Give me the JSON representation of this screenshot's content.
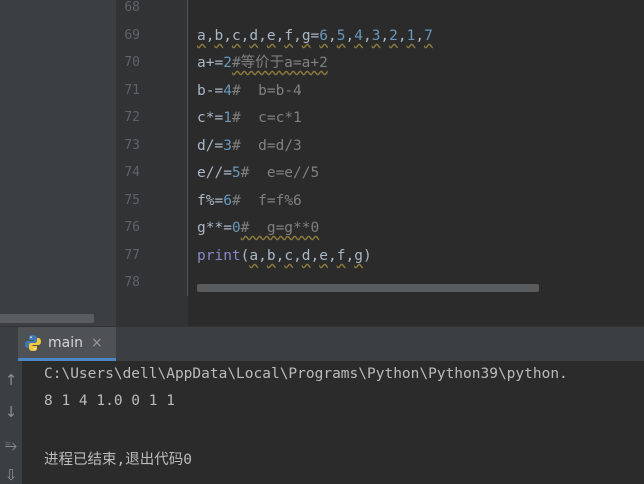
{
  "editor": {
    "line_numbers": [
      "68",
      "69",
      "70",
      "71",
      "72",
      "73",
      "74",
      "75",
      "76",
      "77",
      "78"
    ],
    "lines": {
      "l69": {
        "a": "a",
        "b": "b",
        "c": "c",
        "d": "d",
        "e": "e",
        "f": "f",
        "g": "g",
        "eq": "=",
        "n1": "6",
        "n2": "5",
        "n3": "4",
        "n4": "3",
        "n5": "2",
        "n6": "1",
        "n7": "7",
        "sep": ","
      },
      "l70": {
        "code": "a+=",
        "num": "2",
        "comment": "#等价于a=a+2"
      },
      "l71": {
        "code": "b-=",
        "num": "4",
        "comment": "#  b=b-4"
      },
      "l72": {
        "code": "c*=",
        "num": "1",
        "comment": "#  c=c*1"
      },
      "l73": {
        "code": "d/=",
        "num": "3",
        "comment": "#  d=d/3"
      },
      "l74": {
        "code": "e//=",
        "num": "5",
        "comment": "#  e=e//5"
      },
      "l75": {
        "code": "f%=",
        "num": "6",
        "comment": "#  f=f%6"
      },
      "l76": {
        "code": "g**=",
        "num": "0",
        "comment": "#  g=g**0"
      },
      "l77": {
        "func": "print",
        "open": "(",
        "args": [
          "a",
          "b",
          "c",
          "d",
          "e",
          "f",
          "g"
        ],
        "close": ")"
      }
    }
  },
  "run_panel": {
    "tab_label": "main",
    "close_glyph": "×",
    "output": [
      "C:\\Users\\dell\\AppData\\Local\\Programs\\Python\\Python39\\python.",
      "8 1 4 1.0 0 1 1",
      "",
      "进程已结束,退出代码0"
    ]
  },
  "icons": {
    "up": "↑",
    "down": "↓",
    "wrap": "⥱",
    "scroll_end": "⇩"
  },
  "colors": {
    "editor_bg": "#2b2b2b",
    "number": "#6897bb",
    "comment": "#808080",
    "builtin": "#8888c6",
    "tab_accent": "#4a88c7"
  }
}
